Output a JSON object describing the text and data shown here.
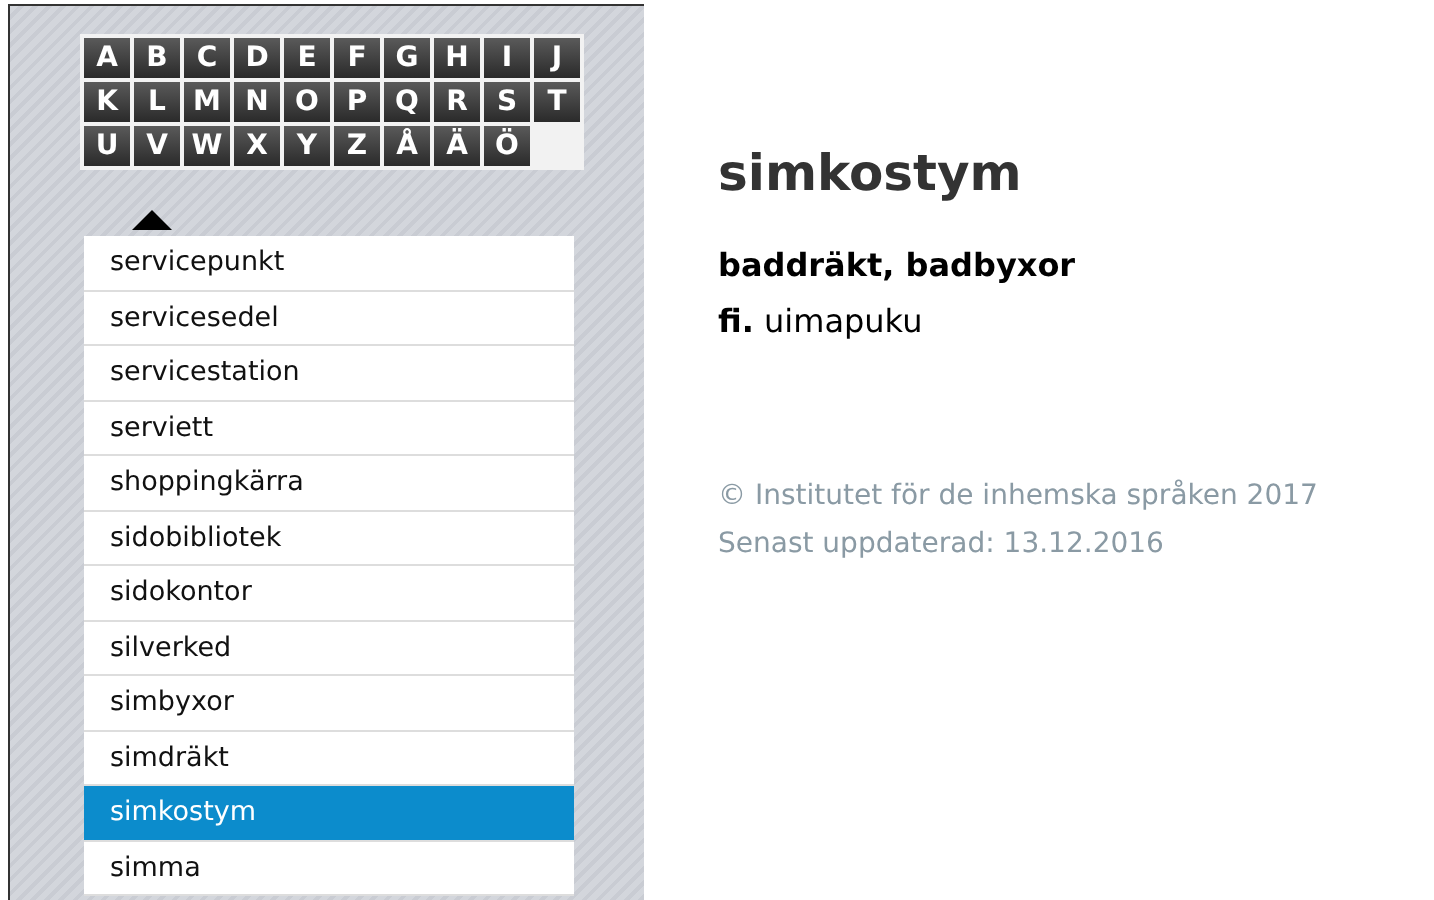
{
  "alphabet": [
    {
      "letter": "A"
    },
    {
      "letter": "B"
    },
    {
      "letter": "C"
    },
    {
      "letter": "D"
    },
    {
      "letter": "E"
    },
    {
      "letter": "F"
    },
    {
      "letter": "G"
    },
    {
      "letter": "H"
    },
    {
      "letter": "I"
    },
    {
      "letter": "J"
    },
    {
      "letter": "K"
    },
    {
      "letter": "L"
    },
    {
      "letter": "M"
    },
    {
      "letter": "N"
    },
    {
      "letter": "O"
    },
    {
      "letter": "P"
    },
    {
      "letter": "Q"
    },
    {
      "letter": "R"
    },
    {
      "letter": "S"
    },
    {
      "letter": "T"
    },
    {
      "letter": "U"
    },
    {
      "letter": "V"
    },
    {
      "letter": "W"
    },
    {
      "letter": "X"
    },
    {
      "letter": "Y"
    },
    {
      "letter": "Z"
    },
    {
      "letter": "Å"
    },
    {
      "letter": "Ä"
    },
    {
      "letter": "Ö"
    }
  ],
  "words": [
    {
      "label": "servicepunkt",
      "selected": false
    },
    {
      "label": "servicesedel",
      "selected": false
    },
    {
      "label": "servicestation",
      "selected": false
    },
    {
      "label": "serviett",
      "selected": false
    },
    {
      "label": "shoppingkärra",
      "selected": false
    },
    {
      "label": "sidobibliotek",
      "selected": false
    },
    {
      "label": "sidokontor",
      "selected": false
    },
    {
      "label": "silverked",
      "selected": false
    },
    {
      "label": "simbyxor",
      "selected": false
    },
    {
      "label": "simdräkt",
      "selected": false
    },
    {
      "label": "simkostym",
      "selected": true
    },
    {
      "label": "simma",
      "selected": false
    }
  ],
  "entry": {
    "headword": "simkostym",
    "synonyms": "baddräkt, badbyxor",
    "translation": "**fi.** uimapuku"
  },
  "footer": {
    "copyright": "© Institutet för de inhemska språken 2017",
    "updated": "Senast uppdaterad: 13.12.2016"
  }
}
